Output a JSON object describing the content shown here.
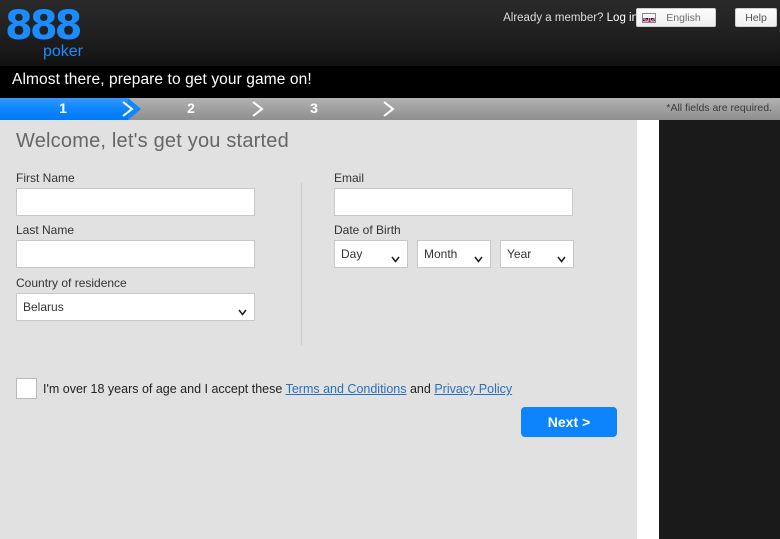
{
  "header": {
    "logo_main": "888",
    "logo_sub": "poker",
    "member_prompt": "Already a member?",
    "login_label": "Log in",
    "language": "English",
    "language_flag": "uk-flag-icon",
    "help_label": "Help"
  },
  "banner": {
    "text": "Almost there, prepare to get your game on!"
  },
  "steps": {
    "items": [
      {
        "label": "1",
        "state": "active"
      },
      {
        "label": "2",
        "state": "inactive"
      },
      {
        "label": "3",
        "state": "inactive"
      }
    ],
    "required_note": "*All fields are required."
  },
  "form": {
    "title": "Welcome, let's get you started",
    "first_name": {
      "label": "First Name",
      "value": "",
      "placeholder": ""
    },
    "last_name": {
      "label": "Last Name",
      "value": "",
      "placeholder": ""
    },
    "country": {
      "label": "Country of residence",
      "value": "Belarus",
      "options": [
        "Belarus"
      ]
    },
    "email": {
      "label": "Email",
      "value": "",
      "placeholder": ""
    },
    "dob": {
      "label": "Date of Birth",
      "day": {
        "value": "Day",
        "options": [
          "Day"
        ]
      },
      "month": {
        "value": "Month",
        "options": [
          "Month"
        ]
      },
      "year": {
        "value": "Year",
        "options": [
          "Year"
        ]
      }
    },
    "terms": {
      "checked": false,
      "text_before": "I'm over 18 years of age and I accept these",
      "link_terms": "Terms and Conditions",
      "text_between": "and",
      "link_privacy": "Privacy Policy"
    },
    "next_label": "Next >"
  },
  "colors": {
    "accent_blue": "#0d84fb",
    "step_active": "#1187fd",
    "link_blue": "#2a6fbd",
    "panel_gray": "#e1e1e1",
    "panel_black": "#1a1a1a"
  }
}
